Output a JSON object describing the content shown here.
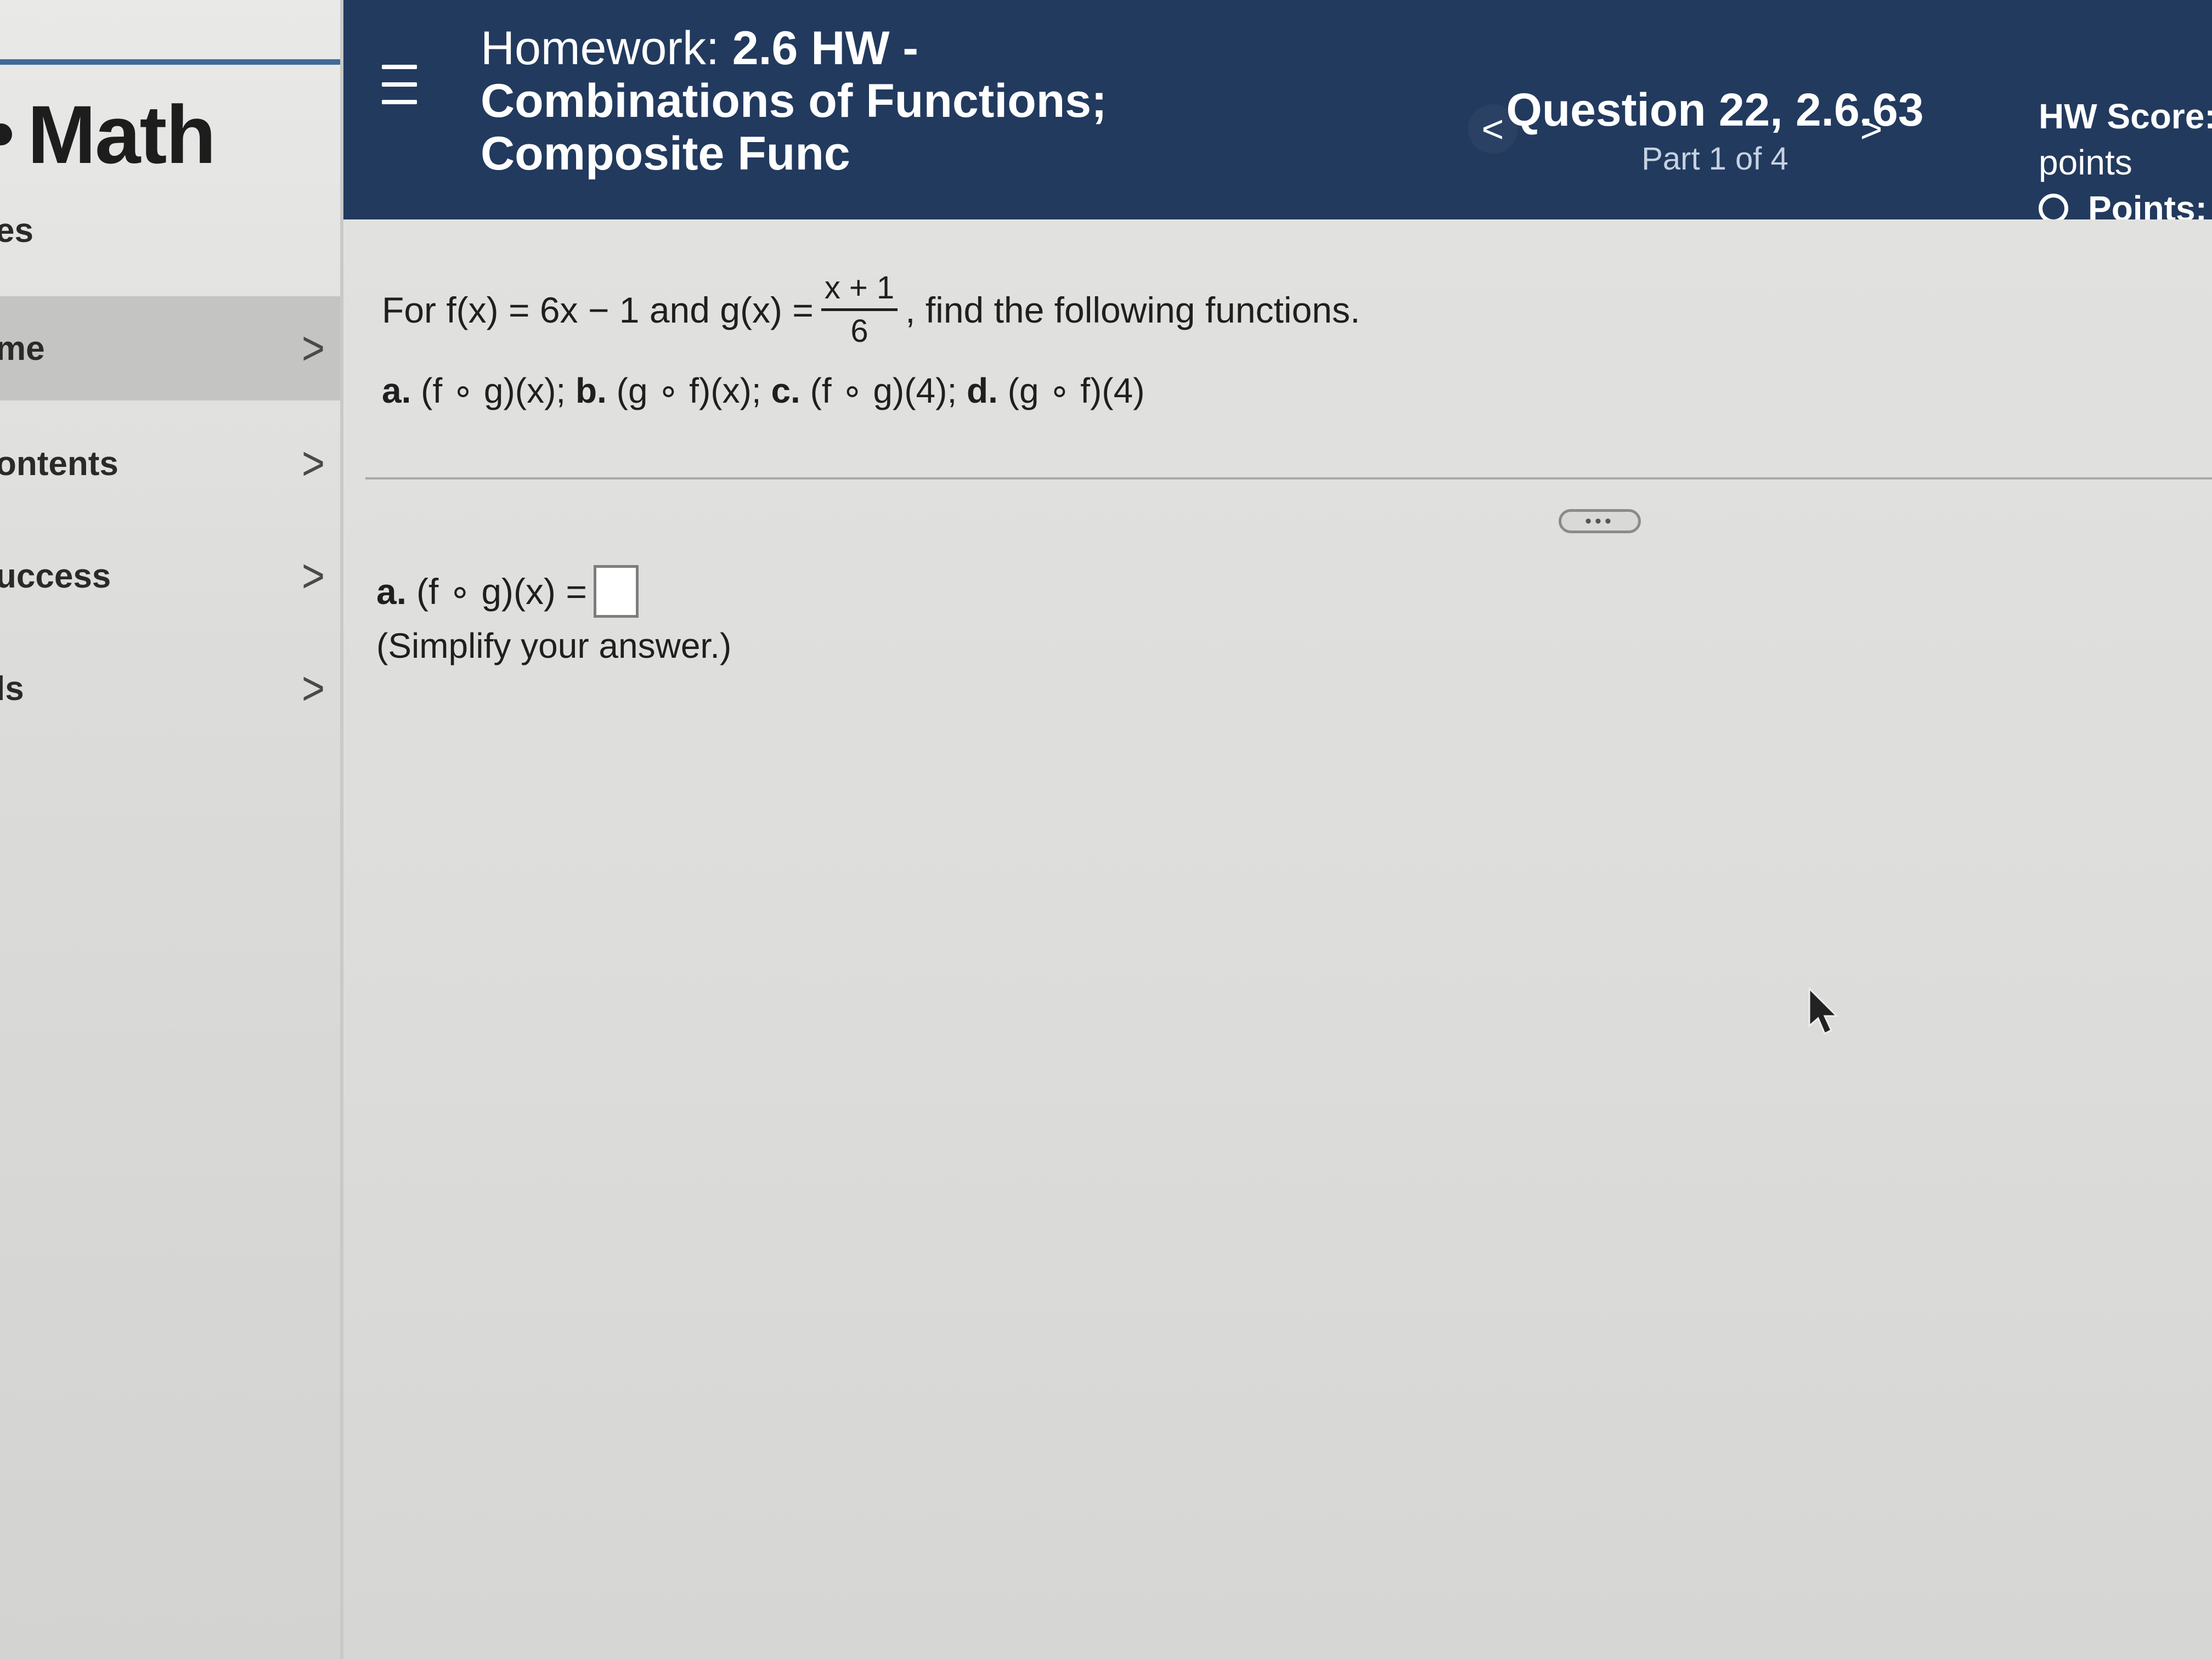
{
  "sidebar": {
    "brand": "Math",
    "partial_above": "es",
    "items": [
      {
        "label": "me",
        "chevron": ">",
        "active": true
      },
      {
        "label": "ontents",
        "chevron": ">",
        "active": false
      },
      {
        "label": "uccess",
        "chevron": ">",
        "active": false
      },
      {
        "label": "ls",
        "chevron": ">",
        "active": false
      }
    ]
  },
  "header": {
    "menu_icon": "hamburger-menu-icon",
    "homework_prefix": "Homework:",
    "homework_title_line1": "2.6 HW -",
    "homework_title_line2": "Combinations of Functions;",
    "homework_title_line3": "Composite Func",
    "prev_label": "<",
    "next_label": ">",
    "question_title": "Question 22, 2.6.63",
    "question_part": "Part 1 of 4",
    "hw_score_label": "HW Score:",
    "hw_score_unit": "points",
    "points_label": "Points:"
  },
  "problem": {
    "intro": "For f(x) = 6x − 1 and g(x) =",
    "fraction_numerator": "x + 1",
    "fraction_denominator": "6",
    "outro": ", find the following functions.",
    "parts": [
      {
        "letter": "a.",
        "text": "(f ∘ g)(x);"
      },
      {
        "letter": "b.",
        "text": "(g ∘ f)(x);"
      },
      {
        "letter": "c.",
        "text": "(f ∘ g)(4);"
      },
      {
        "letter": "d.",
        "text": "(g ∘ f)(4)"
      }
    ]
  },
  "more_button": "•••",
  "answer": {
    "letter": "a.",
    "prompt": "(f ∘ g)(x) =",
    "value": "",
    "hint": "(Simplify your answer.)"
  },
  "colors": {
    "header_bg": "#223a5e",
    "sidebar_rule": "#3f6a97",
    "page_bg": "#dddddb"
  }
}
